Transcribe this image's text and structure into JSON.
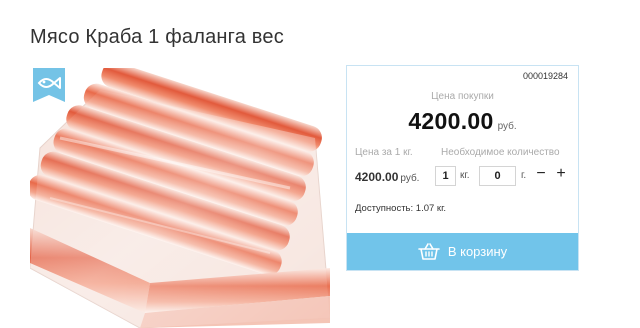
{
  "product": {
    "title": "Мясо Краба 1 фаланга вес",
    "image_alt": "Мясо краба, фаланги в вакуумной упаковке",
    "badge_icon": "fish-icon"
  },
  "purchase": {
    "sku": "000019284",
    "price_label": "Цена покупки",
    "price": "4200.00",
    "price_unit": "руб.",
    "per_kg_label": "Цена за 1 кг.",
    "per_kg_price": "4200.00",
    "per_kg_unit": "руб.",
    "quantity_label": "Необходимое количество",
    "qty_kg": "1",
    "qty_kg_unit": "кг.",
    "qty_g": "0",
    "qty_g_unit": "г.",
    "minus_label": "−",
    "plus_label": "+",
    "availability": "Доступность: 1.07 кг.",
    "cart_button_label": "В корзину",
    "cart_icon": "basket-icon"
  },
  "colors": {
    "accent": "#71c4ea",
    "panel_border": "#c8e3f3"
  }
}
